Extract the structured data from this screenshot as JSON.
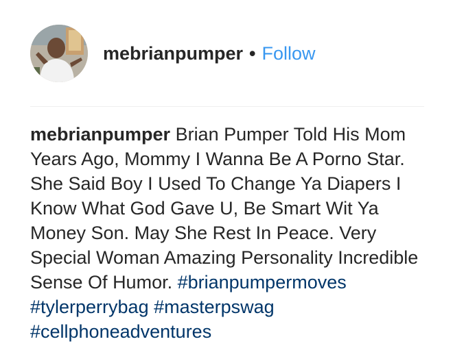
{
  "header": {
    "username": "mebrianpumper",
    "separator": "•",
    "follow_label": "Follow",
    "avatar_icon": "profile-photo"
  },
  "caption": {
    "username": "mebrianpumper",
    "text": "Brian Pumper Told His Mom Years Ago, Mommy I Wanna Be A Porno Star. She Said Boy I Used To Change Ya Diapers I Know What God Gave U, Be Smart Wit Ya Money Son. May She Rest In Peace. Very Special Woman Amazing Personality Incredible Sense Of Humor.",
    "hashtags": [
      "#brianpumpermoves",
      "#tylerperrybag",
      "#masterpswag",
      "#cellphoneadventures"
    ]
  },
  "colors": {
    "text": "#262626",
    "follow": "#3897f0",
    "hashtag": "#003569",
    "divider": "#efefef"
  }
}
